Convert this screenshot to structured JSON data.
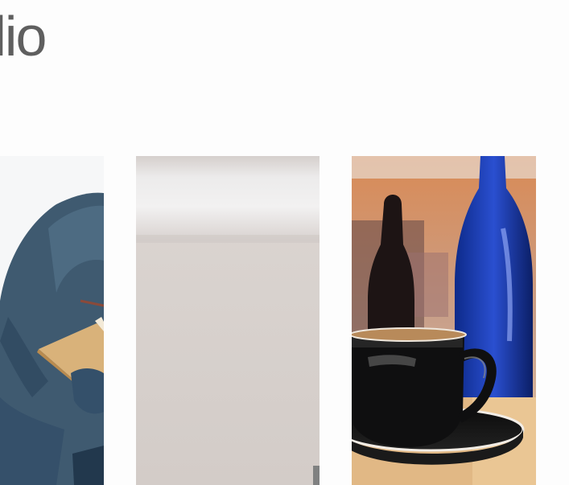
{
  "header": {
    "title": "folio"
  },
  "portfolio": {
    "items": [
      {
        "image": "person-reading-book-photo"
      },
      {
        "image": "blurred-wall-photo"
      },
      {
        "image": "coffee-cup-and-blue-bottle-photo"
      }
    ]
  }
}
